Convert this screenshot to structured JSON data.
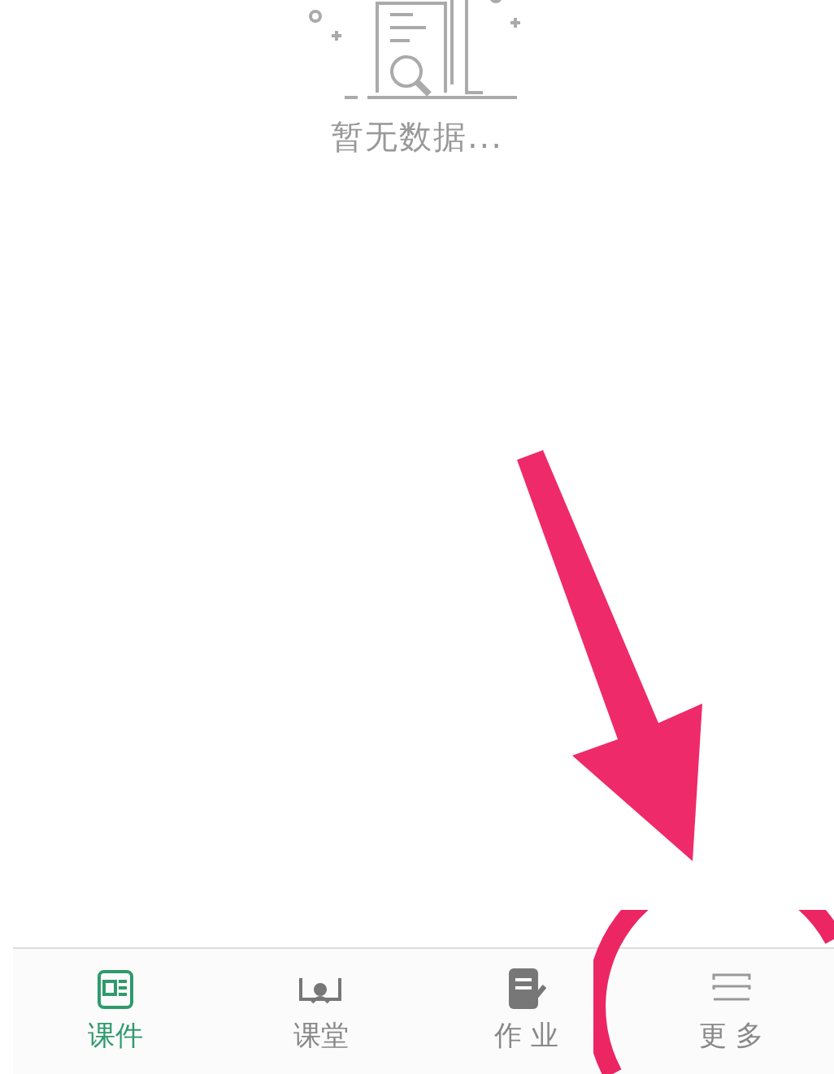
{
  "empty_state": {
    "message": "暂无数据..."
  },
  "tabs": [
    {
      "label": "课件",
      "selected": true,
      "kind": "courseware"
    },
    {
      "label": "课堂",
      "selected": false,
      "kind": "classroom"
    },
    {
      "label": "作 业",
      "selected": false,
      "kind": "homework"
    },
    {
      "label": "更 多",
      "selected": false,
      "kind": "more"
    }
  ]
}
